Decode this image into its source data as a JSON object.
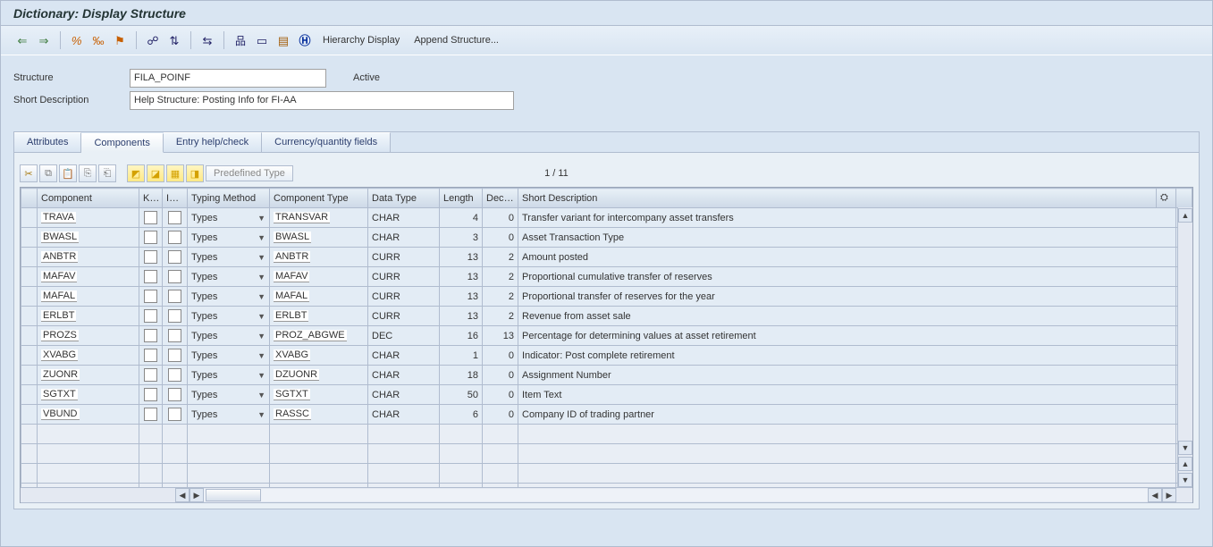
{
  "window": {
    "title": "Dictionary: Display Structure"
  },
  "toolbar": {
    "hierarchy_display": "Hierarchy Display",
    "append_structure": "Append Structure..."
  },
  "meta": {
    "structure_label": "Structure",
    "structure_value": "FILA_POINF",
    "status": "Active",
    "short_desc_label": "Short Description",
    "short_desc_value": "Help Structure: Posting Info for FI-AA"
  },
  "tabs": {
    "attributes": "Attributes",
    "components": "Components",
    "entry_help_check": "Entry help/check",
    "currency_qty": "Currency/quantity fields"
  },
  "inner_toolbar": {
    "predefined_type": "Predefined Type",
    "row_counter": "1  /  11"
  },
  "grid": {
    "headers": {
      "component": "Component",
      "key": "Key",
      "init": "Ini...",
      "typing_method": "Typing Method",
      "component_type": "Component Type",
      "data_type": "Data Type",
      "length": "Length",
      "decimals": "Deci...",
      "short_description": "Short Description"
    },
    "rows": [
      {
        "component": "TRAVA",
        "typing_method": "Types",
        "component_type": "TRANSVAR",
        "data_type": "CHAR",
        "length": "4",
        "decimals": "0",
        "short_description": "Transfer variant for intercompany asset transfers"
      },
      {
        "component": "BWASL",
        "typing_method": "Types",
        "component_type": "BWASL",
        "data_type": "CHAR",
        "length": "3",
        "decimals": "0",
        "short_description": "Asset Transaction Type"
      },
      {
        "component": "ANBTR",
        "typing_method": "Types",
        "component_type": "ANBTR",
        "data_type": "CURR",
        "length": "13",
        "decimals": "2",
        "short_description": "Amount posted"
      },
      {
        "component": "MAFAV",
        "typing_method": "Types",
        "component_type": "MAFAV",
        "data_type": "CURR",
        "length": "13",
        "decimals": "2",
        "short_description": "Proportional cumulative transfer of reserves"
      },
      {
        "component": "MAFAL",
        "typing_method": "Types",
        "component_type": "MAFAL",
        "data_type": "CURR",
        "length": "13",
        "decimals": "2",
        "short_description": "Proportional transfer of reserves for the year"
      },
      {
        "component": "ERLBT",
        "typing_method": "Types",
        "component_type": "ERLBT",
        "data_type": "CURR",
        "length": "13",
        "decimals": "2",
        "short_description": "Revenue from asset sale"
      },
      {
        "component": "PROZS",
        "typing_method": "Types",
        "component_type": "PROZ_ABGWE",
        "data_type": "DEC",
        "length": "16",
        "decimals": "13",
        "short_description": "Percentage for determining values at asset retirement"
      },
      {
        "component": "XVABG",
        "typing_method": "Types",
        "component_type": "XVABG",
        "data_type": "CHAR",
        "length": "1",
        "decimals": "0",
        "short_description": "Indicator: Post complete retirement"
      },
      {
        "component": "ZUONR",
        "typing_method": "Types",
        "component_type": "DZUONR",
        "data_type": "CHAR",
        "length": "18",
        "decimals": "0",
        "short_description": "Assignment Number"
      },
      {
        "component": "SGTXT",
        "typing_method": "Types",
        "component_type": "SGTXT",
        "data_type": "CHAR",
        "length": "50",
        "decimals": "0",
        "short_description": "Item Text"
      },
      {
        "component": "VBUND",
        "typing_method": "Types",
        "component_type": "RASSC",
        "data_type": "CHAR",
        "length": "6",
        "decimals": "0",
        "short_description": "Company ID of trading partner"
      }
    ]
  }
}
